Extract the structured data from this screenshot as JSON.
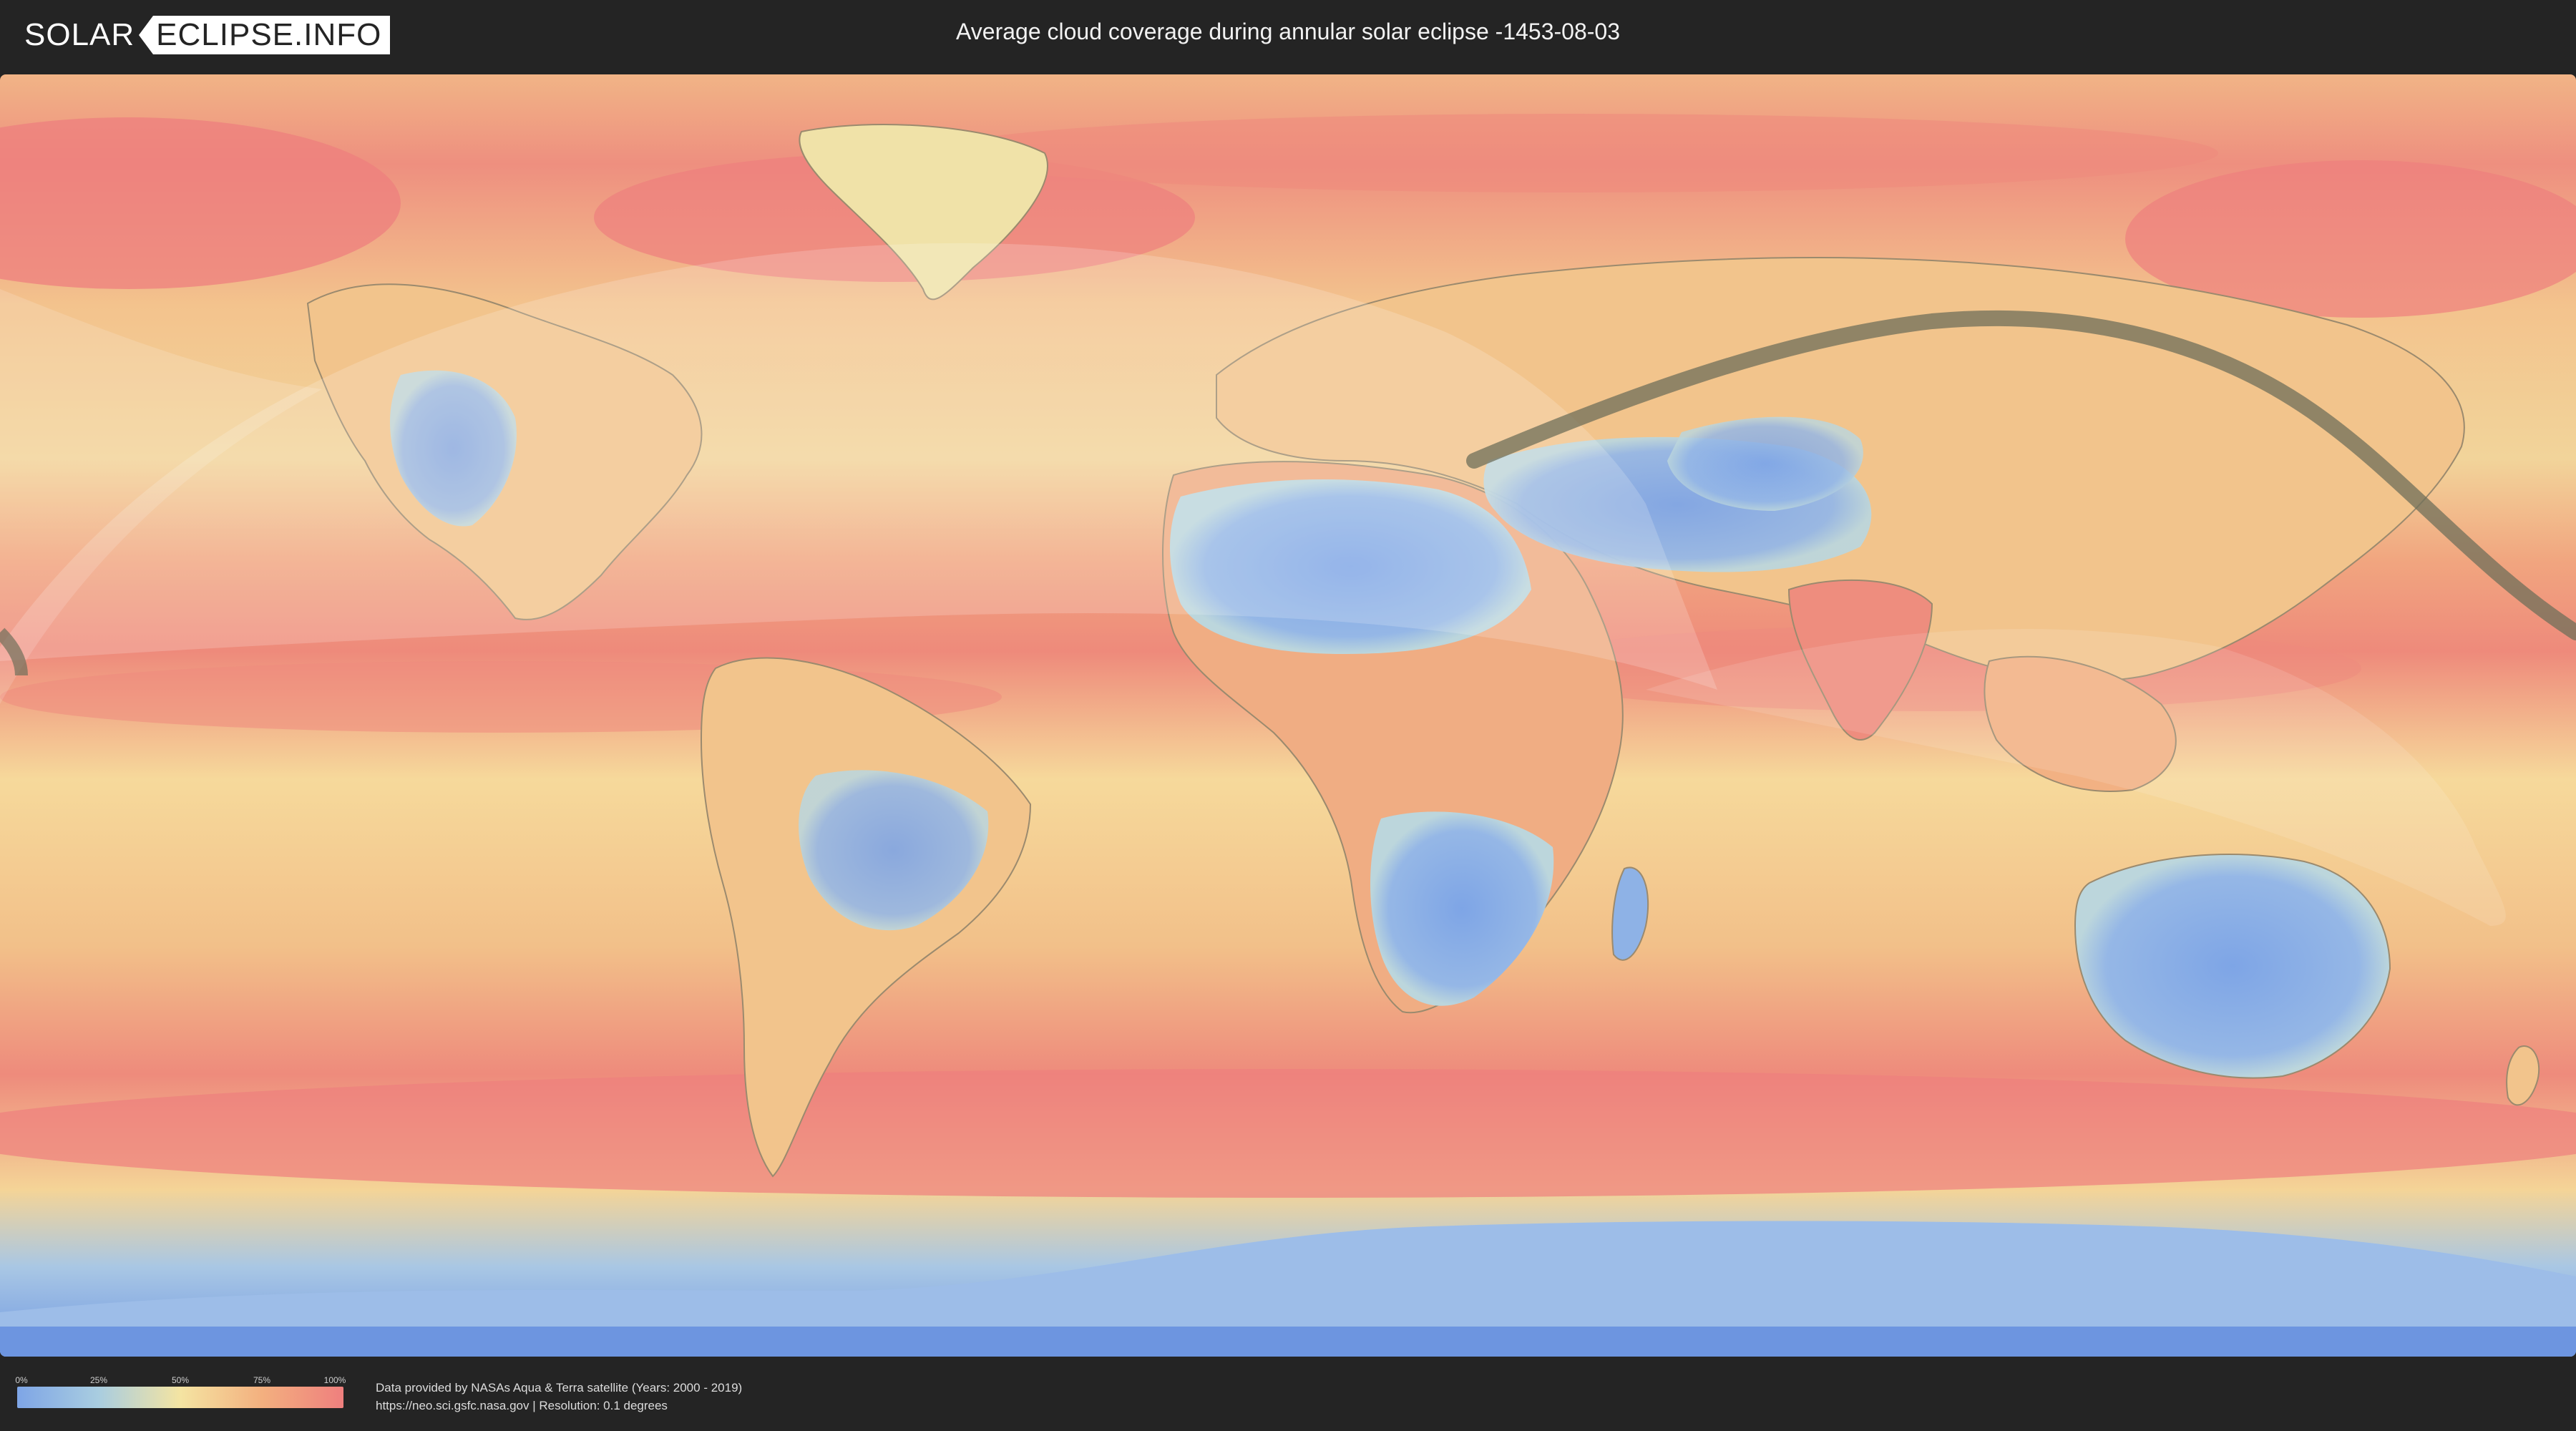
{
  "header": {
    "logo_left": "SOLAR",
    "logo_right": "ECLIPSE.INFO",
    "title": "Average cloud coverage during annular solar eclipse -1453-08-03"
  },
  "map": {
    "type": "world-cloud-coverage",
    "colors": {
      "clear": "#7ea5e6",
      "low": "#a9cde0",
      "mid": "#f4e4a2",
      "high": "#f3b07f",
      "overcast": "#ef7f7e",
      "eclipse_path": "#6f6f5a"
    }
  },
  "legend": {
    "ticks": [
      "0%",
      "25%",
      "50%",
      "75%",
      "100%"
    ]
  },
  "footer": {
    "credit_line1": "Data provided by NASAs Aqua & Terra satellite (Years: 2000 - 2019)",
    "credit_line2": "https://neo.sci.gsfc.nasa.gov | Resolution: 0.1 degrees"
  }
}
